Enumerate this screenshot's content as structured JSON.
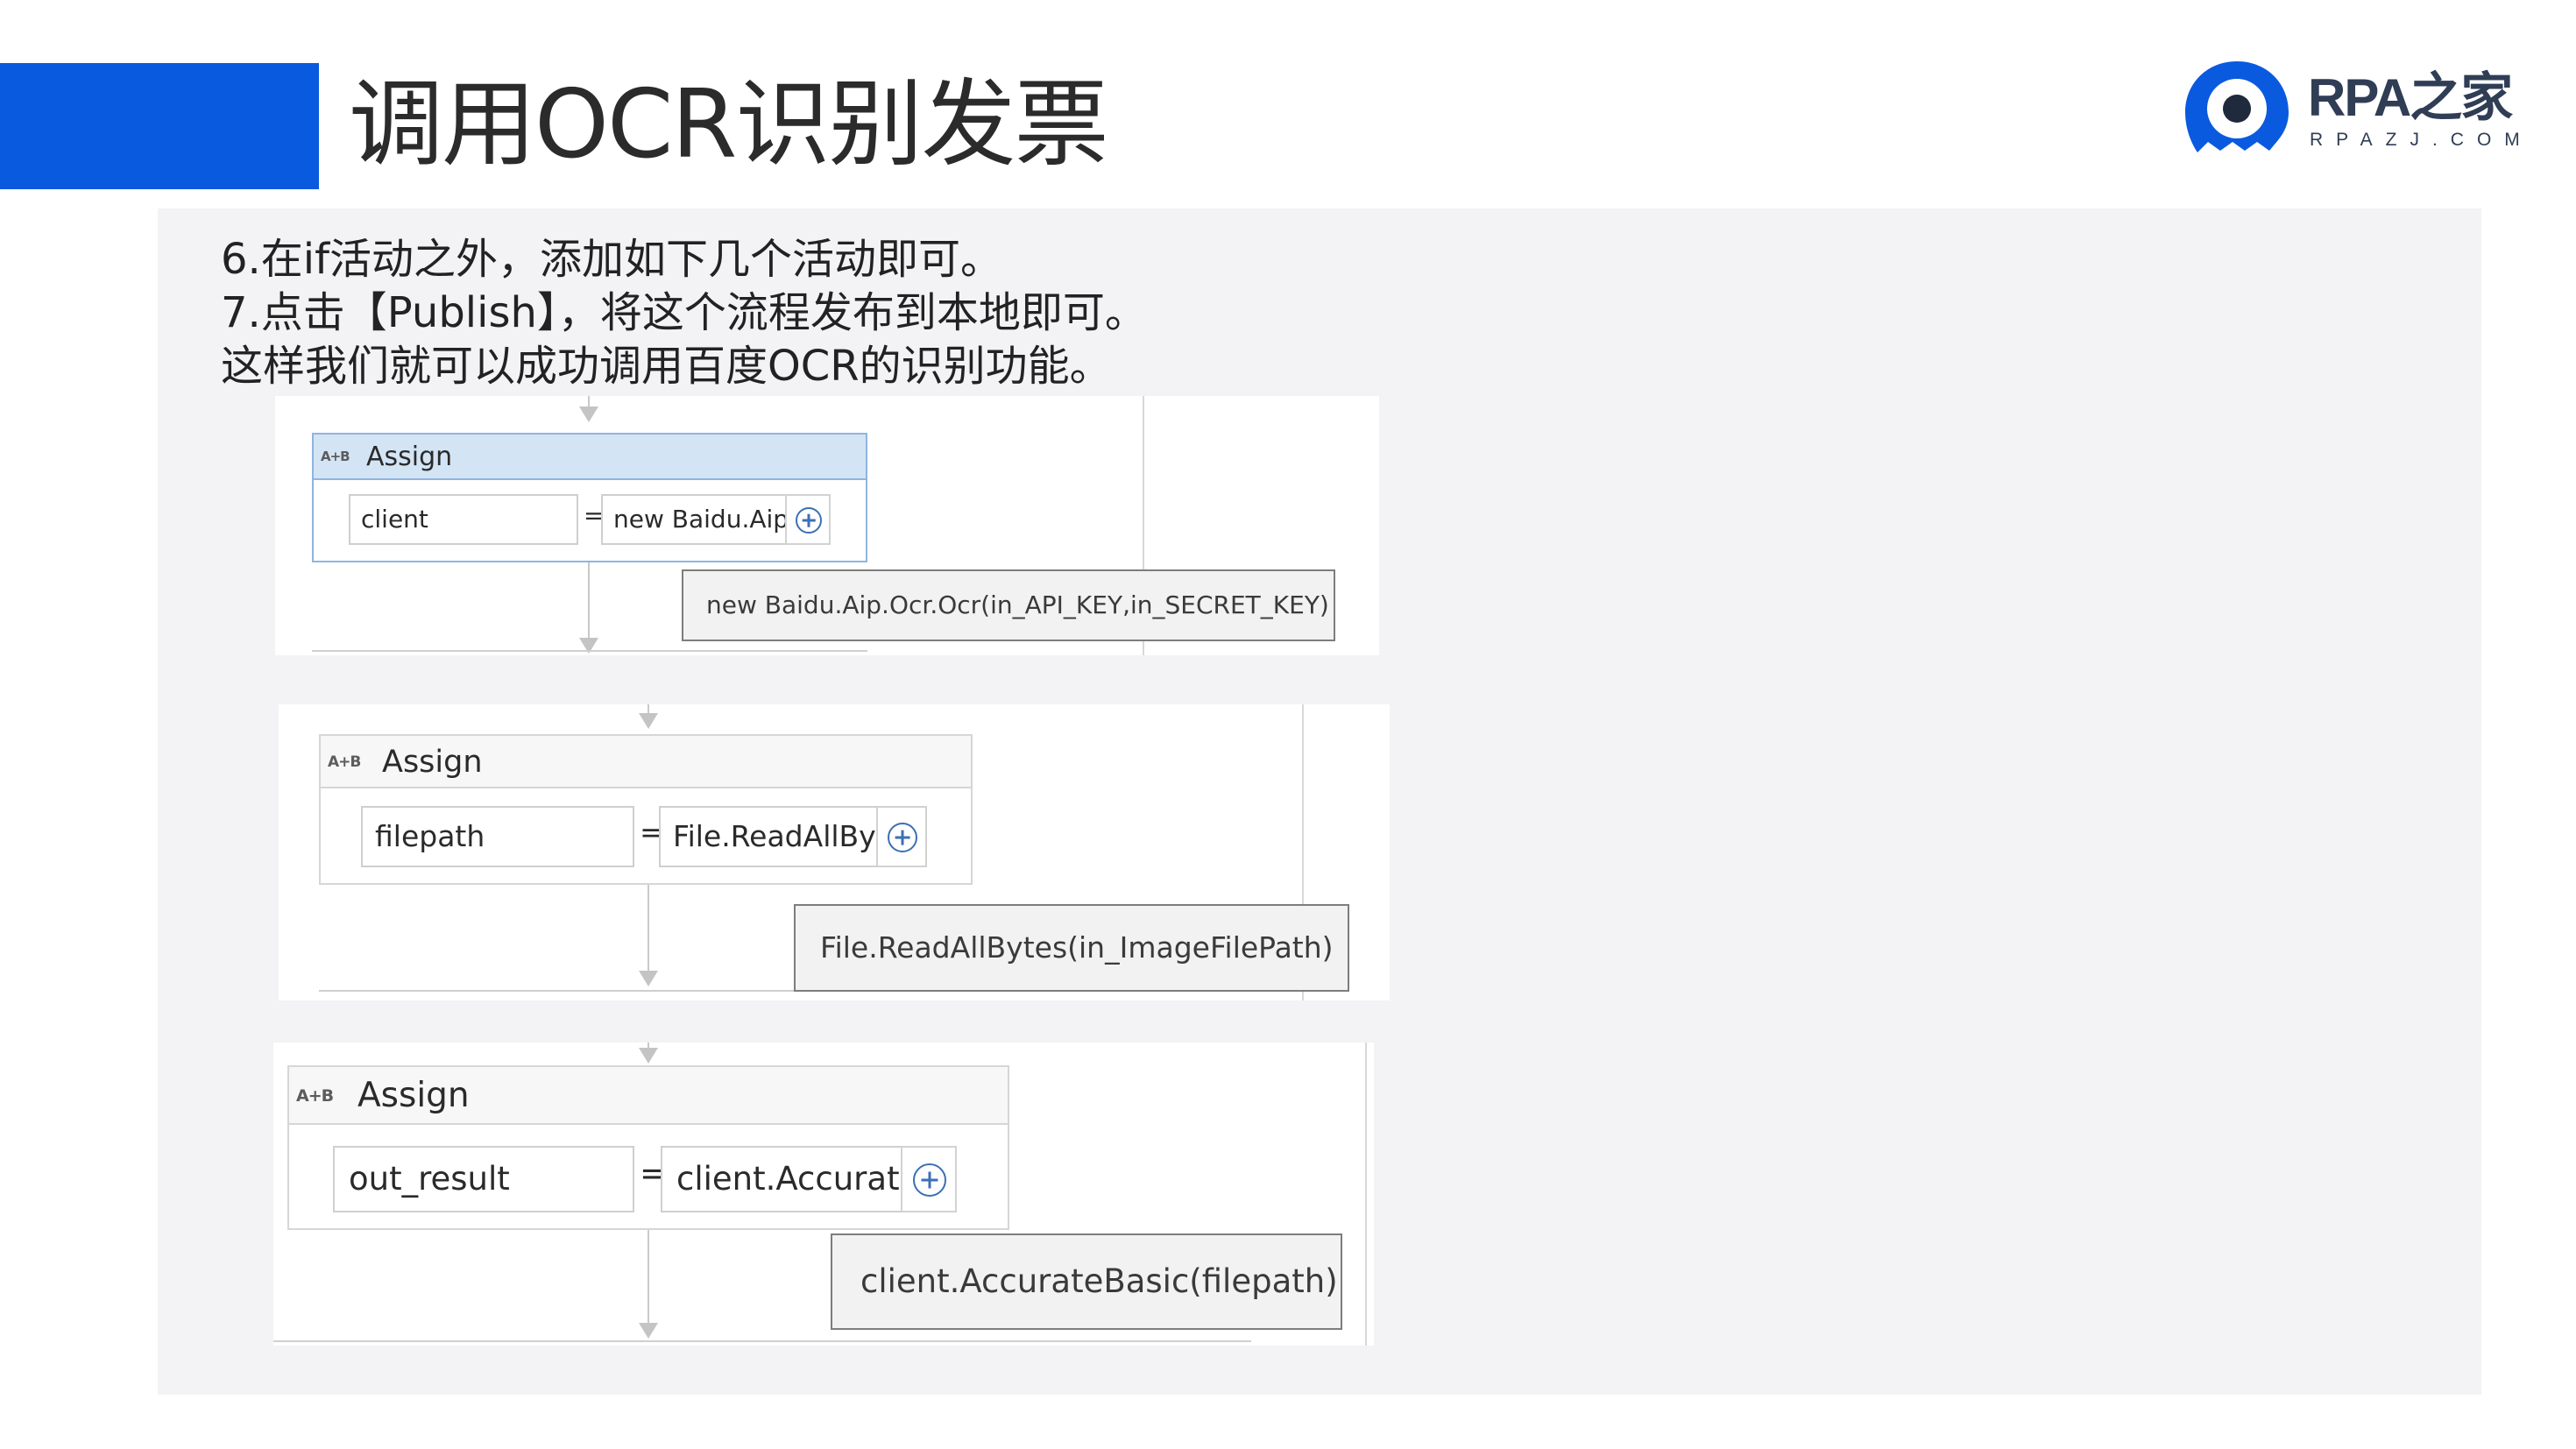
{
  "slide": {
    "title": "调用OCR识别发票",
    "accent_color": "#0a5ae0"
  },
  "logo": {
    "name": "RPA之家",
    "subtitle": "RPAZJ.COM",
    "icon": "eye-badge-icon"
  },
  "instructions": [
    "6.在if活动之外，添加如下几个活动即可。",
    "7.点击【Publish】，将这个流程发布到本地即可。",
    "这样我们就可以成功调用百度OCR的识别功能。"
  ],
  "activities": [
    {
      "icon_text": "A+B",
      "title": "Assign",
      "to": "client",
      "equals": "=",
      "value": "new Baidu.Aip.Ocr.Ocr(in_API_KEY,in_SECRET_KEY)",
      "value_truncated": "new Baidu.Aip",
      "tooltip": "new Baidu.Aip.Ocr.Ocr(in_API_KEY,in_SECRET_KEY)"
    },
    {
      "icon_text": "A+B",
      "title": "Assign",
      "to": "filepath",
      "equals": "=",
      "value": "File.ReadAllBytes(in_ImageFilePath)",
      "value_truncated": "File.ReadAllBy",
      "tooltip": "File.ReadAllBytes(in_ImageFilePath)"
    },
    {
      "icon_text": "A+B",
      "title": "Assign",
      "to": "out_result",
      "equals": "=",
      "value": "client.AccurateBasic(filepath)",
      "value_truncated": "client.Accurat",
      "tooltip": "client.AccurateBasic(filepath)"
    }
  ]
}
